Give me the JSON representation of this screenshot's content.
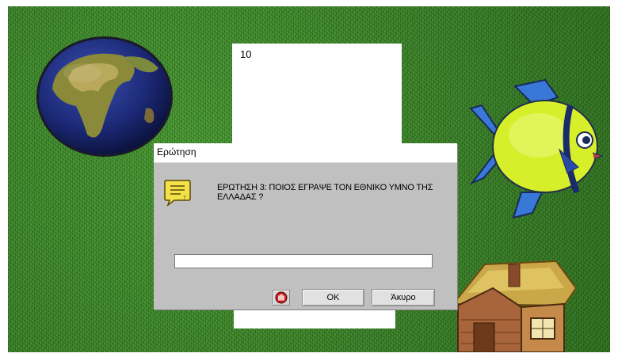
{
  "background": {
    "score_text": "10"
  },
  "dialog": {
    "title": "Ερώτηση",
    "question": "ΕΡΩΤΗΣΗ 3: ΠΟΙΟΣ ΕΓΡΑΨΕ ΤΟΝ ΕΘΝΙΚΟ ΥΜΝΟ ΤΗΣ ΕΛΛΑΔΑΣ ?",
    "answer_value": "",
    "ok_label": "OK",
    "cancel_label": "Άκυρο",
    "icons": {
      "message": "message-icon",
      "help": "help-icon"
    }
  },
  "decorations": [
    "globe-icon",
    "fish-icon",
    "house-icon"
  ],
  "colors": {
    "grass": "#3f8a2a",
    "dialog_face": "#c0c0c0",
    "message_icon": "#f2e14a"
  }
}
